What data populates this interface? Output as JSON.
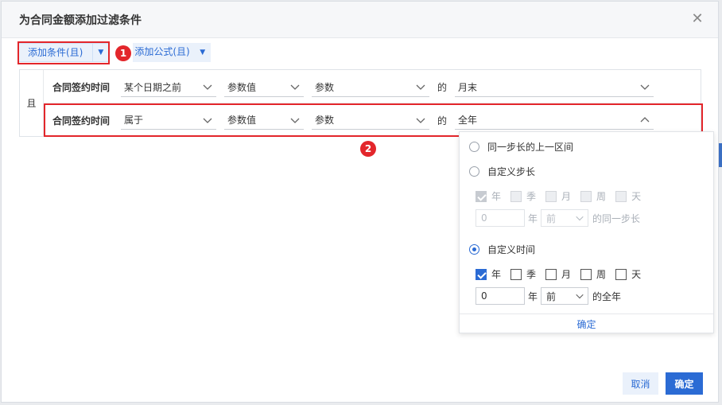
{
  "dialog": {
    "title": "为合同金额添加过滤条件"
  },
  "toolbar": {
    "add_condition": "添加条件(且)",
    "add_formula": "添加公式(且)"
  },
  "annotations": [
    "1",
    "2"
  ],
  "conditions": {
    "join_label": "且",
    "rows": [
      {
        "field": "合同签约时间",
        "operator": "某个日期之前",
        "value_type": "参数值",
        "param": "参数",
        "of_label": "的",
        "period": "月末",
        "open": false
      },
      {
        "field": "合同签约时间",
        "operator": "属于",
        "value_type": "参数值",
        "param": "参数",
        "of_label": "的",
        "period": "全年",
        "open": true
      }
    ]
  },
  "dropdown": {
    "opt_prev_interval": "同一步长的上一区间",
    "opt_custom_step": "自定义步长",
    "step_units": [
      {
        "label": "年",
        "checked": true
      },
      {
        "label": "季",
        "checked": false
      },
      {
        "label": "月",
        "checked": false
      },
      {
        "label": "周",
        "checked": false
      },
      {
        "label": "天",
        "checked": false
      }
    ],
    "step_number_placeholder": "0",
    "step_unit_suffix": "年",
    "step_direction": "前",
    "step_tail": "的同一步长",
    "opt_custom_time": "自定义时间",
    "time_units": [
      {
        "label": "年",
        "checked": true
      },
      {
        "label": "季",
        "checked": false
      },
      {
        "label": "月",
        "checked": false
      },
      {
        "label": "周",
        "checked": false
      },
      {
        "label": "天",
        "checked": false
      }
    ],
    "time_number": "0",
    "time_unit_suffix": "年",
    "time_direction": "前",
    "time_tail": "的全年",
    "confirm": "确定"
  },
  "footer": {
    "cancel": "取消",
    "ok": "确定"
  },
  "colors": {
    "accent": "#2b6bd4",
    "highlight": "#e3262b"
  }
}
